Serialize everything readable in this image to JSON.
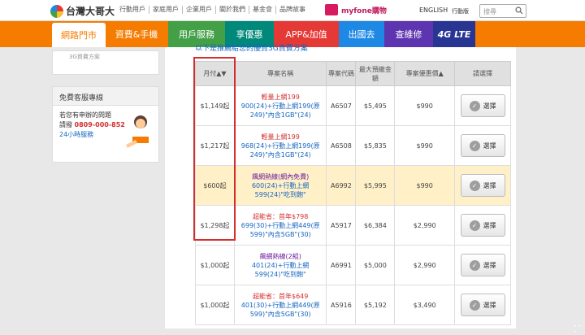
{
  "brand": {
    "name": "台灣大哥大"
  },
  "toplinks": [
    "行動用戶",
    "家庭用戶",
    "企業用戶",
    "關於我們",
    "基金會",
    "品牌故事"
  ],
  "myfone": "myfone購物",
  "lang": "ENGLISH",
  "mobile": "行動版",
  "search": {
    "placeholder": "搜尋"
  },
  "nav": [
    "網路門市",
    "資費&手機",
    "用戶服務",
    "享優惠",
    "APP&加值",
    "出國去",
    "查維修",
    "4G LTE"
  ],
  "nav_colors": [
    "#ffffff",
    "#f57c00",
    "#43a047",
    "#00897b",
    "#e53935",
    "#1e88e5",
    "#5e35b1",
    "#283593"
  ],
  "sidebar": {
    "top": "3G資費方案",
    "service_title": "免費客服專線",
    "line1": "若您有申辦的問題",
    "line2_prefix": "請撥",
    "phone": "0809-000-852",
    "hours": "24小時服務"
  },
  "subtitle": "以下是推薦給您的優質3G資費方案",
  "headers": [
    "月付▲▼",
    "專案名稱",
    "專案代碼",
    "最大預繳金額",
    "專案優惠價▲",
    "請選擇"
  ],
  "rows": [
    {
      "monthly": "$1,149起",
      "tag": "輕量上網199",
      "desc": "900(24)+行動上網199(原249)\"內含1GB\"(24)",
      "code": "A6507",
      "deposit": "$5,495",
      "price": "$990",
      "select": "選擇",
      "tagcls": "red",
      "hl": false
    },
    {
      "monthly": "$1,217起",
      "tag": "輕量上網199",
      "desc": "968(24)+行動上網199(原249)\"內含1GB\"(24)",
      "code": "A6508",
      "deposit": "$5,835",
      "price": "$990",
      "select": "選擇",
      "tagcls": "red",
      "hl": false
    },
    {
      "monthly": "$600起",
      "tag": "飆網熱線(網內免費)",
      "desc": "600(24)+行動上網599(24)\"吃到飽\"",
      "code": "A6992",
      "deposit": "$5,995",
      "price": "$990",
      "select": "選擇",
      "tagcls": "purple",
      "hl": true
    },
    {
      "monthly": "$1,298起",
      "tag": "超能省：首年$798",
      "desc": "699(30)+行動上網449(原599)\"內含5GB\"(30)",
      "code": "A5917",
      "deposit": "$6,384",
      "price": "$2,990",
      "select": "選擇",
      "tagcls": "red",
      "hl": false
    },
    {
      "monthly": "$1,000起",
      "tag": "飆網熱線(2組)",
      "desc": "401(24)+行動上網599(24)\"吃到飽\"",
      "code": "A6991",
      "deposit": "$5,000",
      "price": "$2,990",
      "select": "選擇",
      "tagcls": "purple",
      "hl": false
    },
    {
      "monthly": "$1,000起",
      "tag": "超能省：首年$649",
      "desc": "401(30)+行動上網449(原599)\"內含5GB\"(30)",
      "code": "A5916",
      "deposit": "$5,192",
      "price": "$3,490",
      "select": "選擇",
      "tagcls": "red",
      "hl": false
    }
  ]
}
